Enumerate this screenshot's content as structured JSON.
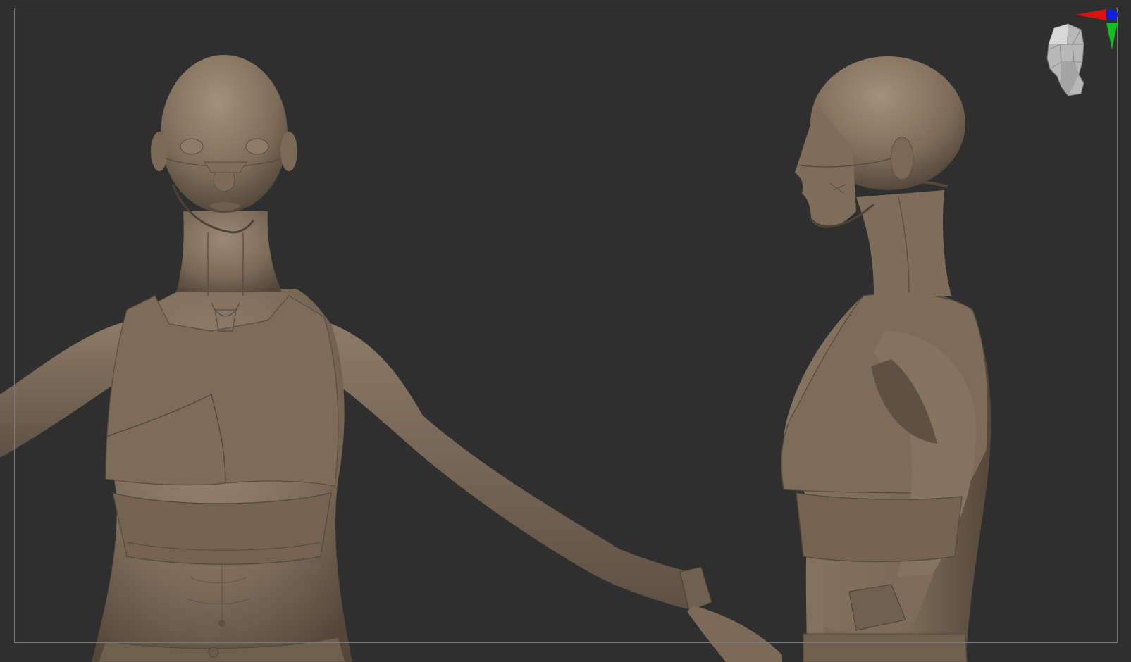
{
  "viewport": {
    "background": "#2f2f2f",
    "frame_border": "#7a7a7a"
  },
  "model": {
    "material_color": "#7a6a58",
    "material_highlight": "#9a8874",
    "material_shadow": "#4e4236"
  },
  "navigation_gizmo": {
    "icon": "head-orientation-icon",
    "axes": {
      "x_color": "#e01010",
      "y_color": "#10c020",
      "z_color": "#1020e0"
    }
  }
}
